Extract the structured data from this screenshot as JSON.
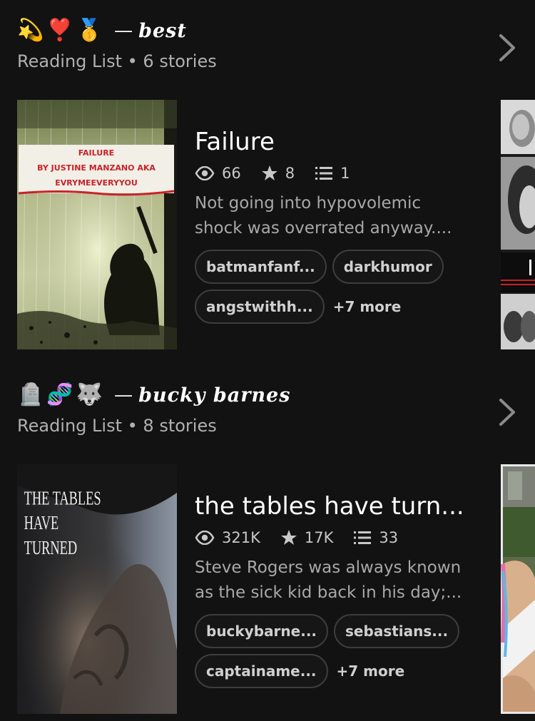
{
  "lists": [
    {
      "emojis": [
        "💫",
        "❣️",
        "🥇"
      ],
      "dash": "—",
      "name": "best",
      "subtitle": "Reading List • 6 stories",
      "story": {
        "title": "Failure",
        "cover_text": [
          "FAILURE",
          "BY JUSTINE MANZANO AKA",
          "EVRYMEEVERYYOU"
        ],
        "reads": "66",
        "votes": "8",
        "parts": "1",
        "description": "Not going into hypovolemic shock was overrated anyway....",
        "tags": [
          "batmanfanf...",
          "darkhumor",
          "angstwithh..."
        ],
        "more": "+7 more"
      }
    },
    {
      "emojis": [
        "🪦",
        "🧬",
        "🐺"
      ],
      "dash": "—",
      "name": "bucky barnes",
      "subtitle": "Reading List • 8 stories",
      "story": {
        "title": "the tables have turn...",
        "cover_text": [
          "THE TABLES",
          "HAVE",
          "TURNED"
        ],
        "reads": "321K",
        "votes": "17K",
        "parts": "33",
        "description": "Steve Rogers was always known as the sick kid back in his day;...",
        "tags": [
          "buckybarne...",
          "sebastians...",
          "captainame..."
        ],
        "more": "+7 more"
      }
    }
  ],
  "icons": {
    "reads": "eye-icon",
    "votes": "star-icon",
    "parts": "list-icon",
    "next": "chevron-right-icon"
  },
  "colors": {
    "background": "#121212",
    "cover_label_red": "#c8222a"
  }
}
